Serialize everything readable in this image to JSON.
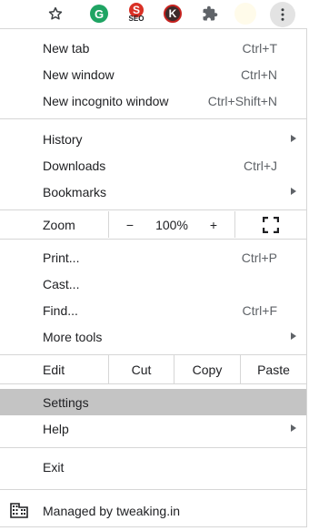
{
  "toolbar": {
    "icons": [
      "star-icon",
      "grammarly-extension-icon",
      "seo-extension-icon",
      "k-extension-icon",
      "puzzle-icon",
      "blank-extension-icon",
      "kebab-menu-icon"
    ],
    "ext_g_letter": "G",
    "ext_s_letter": "S",
    "ext_s_caption": "SEO",
    "ext_k_letter": "K"
  },
  "menu": {
    "new_tab": {
      "label": "New tab",
      "shortcut": "Ctrl+T"
    },
    "new_window": {
      "label": "New window",
      "shortcut": "Ctrl+N"
    },
    "new_incognito": {
      "label": "New incognito window",
      "shortcut": "Ctrl+Shift+N"
    },
    "history": {
      "label": "History"
    },
    "downloads": {
      "label": "Downloads",
      "shortcut": "Ctrl+J"
    },
    "bookmarks": {
      "label": "Bookmarks"
    },
    "zoom": {
      "label": "Zoom",
      "minus": "−",
      "level": "100%",
      "plus": "+"
    },
    "print": {
      "label": "Print...",
      "shortcut": "Ctrl+P"
    },
    "cast": {
      "label": "Cast..."
    },
    "find": {
      "label": "Find...",
      "shortcut": "Ctrl+F"
    },
    "more_tools": {
      "label": "More tools"
    },
    "edit": {
      "label": "Edit",
      "cut": "Cut",
      "copy": "Copy",
      "paste": "Paste"
    },
    "settings": {
      "label": "Settings"
    },
    "help": {
      "label": "Help"
    },
    "exit": {
      "label": "Exit"
    },
    "managed": {
      "label": "Managed by tweaking.in"
    }
  },
  "colors": {
    "selected_row": "#c4c4c4",
    "separator": "#d6d6d6",
    "text": "#202124"
  }
}
